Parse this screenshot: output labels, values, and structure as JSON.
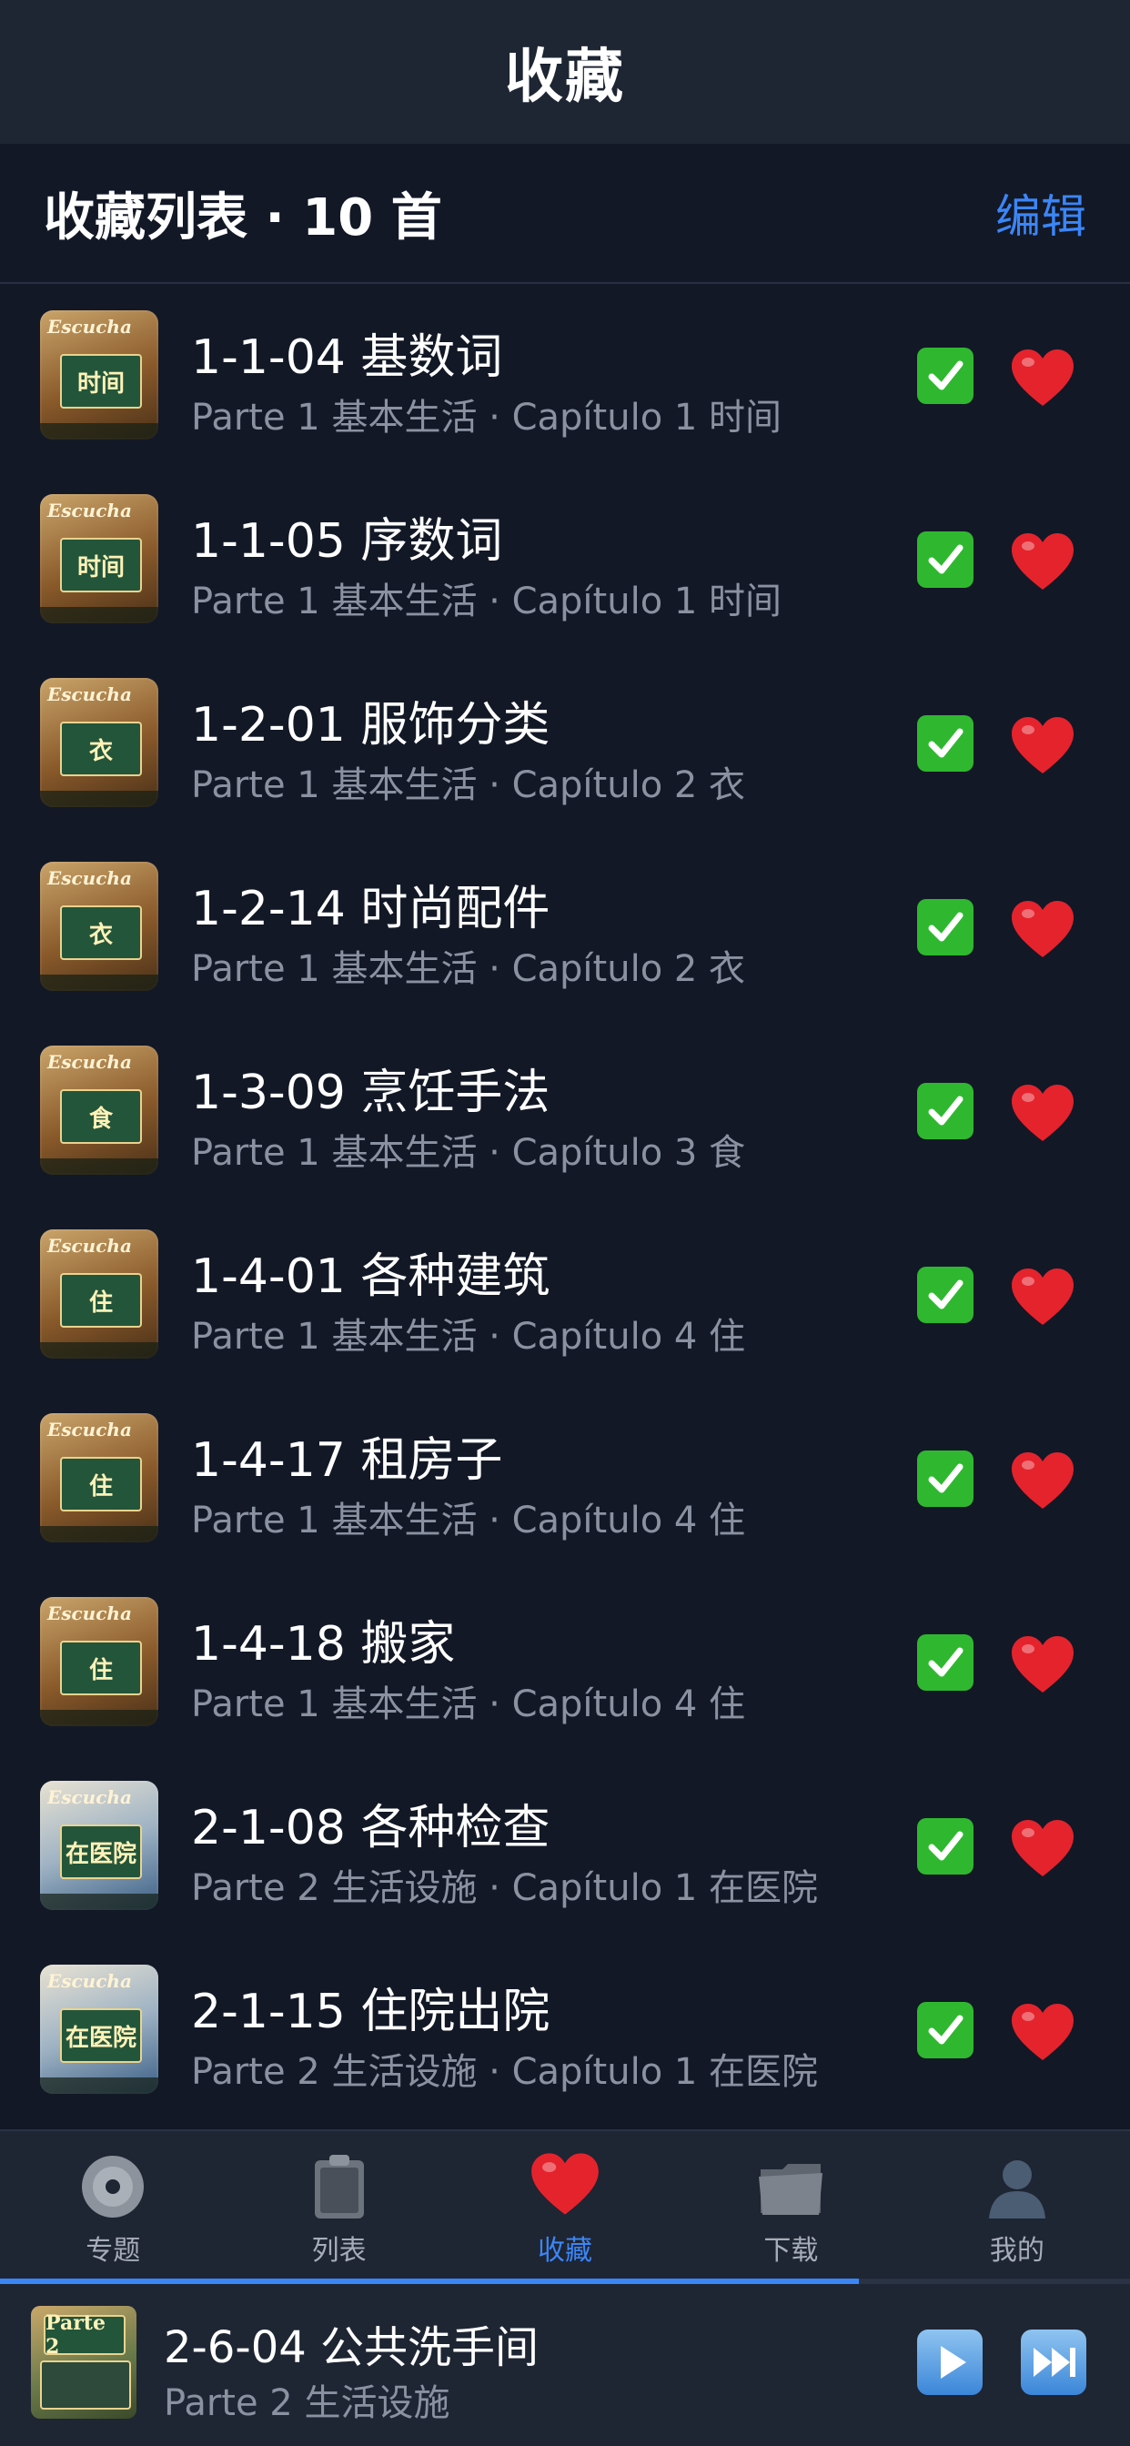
{
  "nav": {
    "title": "收藏"
  },
  "section": {
    "title": "收藏列表 · 10 首",
    "edit_label": "编辑"
  },
  "items": [
    {
      "title": "1-1-04 基数词",
      "subtitle": "Parte 1 基本生活 · Capítulo 1 时间",
      "thumb_label": "时间",
      "thumb_style": "warm"
    },
    {
      "title": "1-1-05 序数词",
      "subtitle": "Parte 1 基本生活 · Capítulo 1 时间",
      "thumb_label": "时间",
      "thumb_style": "warm"
    },
    {
      "title": "1-2-01 服饰分类",
      "subtitle": "Parte 1 基本生活 · Capítulo 2 衣",
      "thumb_label": "衣",
      "thumb_style": "warm"
    },
    {
      "title": "1-2-14 时尚配件",
      "subtitle": "Parte 1 基本生活 · Capítulo 2 衣",
      "thumb_label": "衣",
      "thumb_style": "warm"
    },
    {
      "title": "1-3-09 烹饪手法",
      "subtitle": "Parte 1 基本生活 · Capítulo 3 食",
      "thumb_label": "食",
      "thumb_style": "warm"
    },
    {
      "title": "1-4-01 各种建筑",
      "subtitle": "Parte 1 基本生活 · Capítulo 4 住",
      "thumb_label": "住",
      "thumb_style": "warm"
    },
    {
      "title": "1-4-17 租房子",
      "subtitle": "Parte 1 基本生活 · Capítulo 4 住",
      "thumb_label": "住",
      "thumb_style": "warm"
    },
    {
      "title": "1-4-18 搬家",
      "subtitle": "Parte 1 基本生活 · Capítulo 4 住",
      "thumb_label": "住",
      "thumb_style": "warm"
    },
    {
      "title": "2-1-08 各种检查",
      "subtitle": "Parte 2 生活设施 · Capítulo 1 在医院",
      "thumb_label": "在医院",
      "thumb_style": "blue"
    },
    {
      "title": "2-1-15 住院出院",
      "subtitle": "Parte 2 生活设施 · Capítulo 1 在医院",
      "thumb_label": "在医院",
      "thumb_style": "blue"
    }
  ],
  "thumb_script": "Escucha",
  "tabs": [
    {
      "label": "专题",
      "icon": "disc-icon"
    },
    {
      "label": "列表",
      "icon": "clipboard-icon"
    },
    {
      "label": "收藏",
      "icon": "heart-icon",
      "active": true
    },
    {
      "label": "下载",
      "icon": "folder-icon"
    },
    {
      "label": "我的",
      "icon": "person-icon"
    }
  ],
  "player": {
    "title": "2-6-04 公共洗手间",
    "subtitle": "Parte 2 生活设施",
    "thumb_label": "Parte 2",
    "progress": 0.76
  },
  "colors": {
    "background": "#121826",
    "bar": "#1e2533",
    "accent": "#3b86f7",
    "check": "#2fb82f",
    "heart": "#e5232d"
  }
}
